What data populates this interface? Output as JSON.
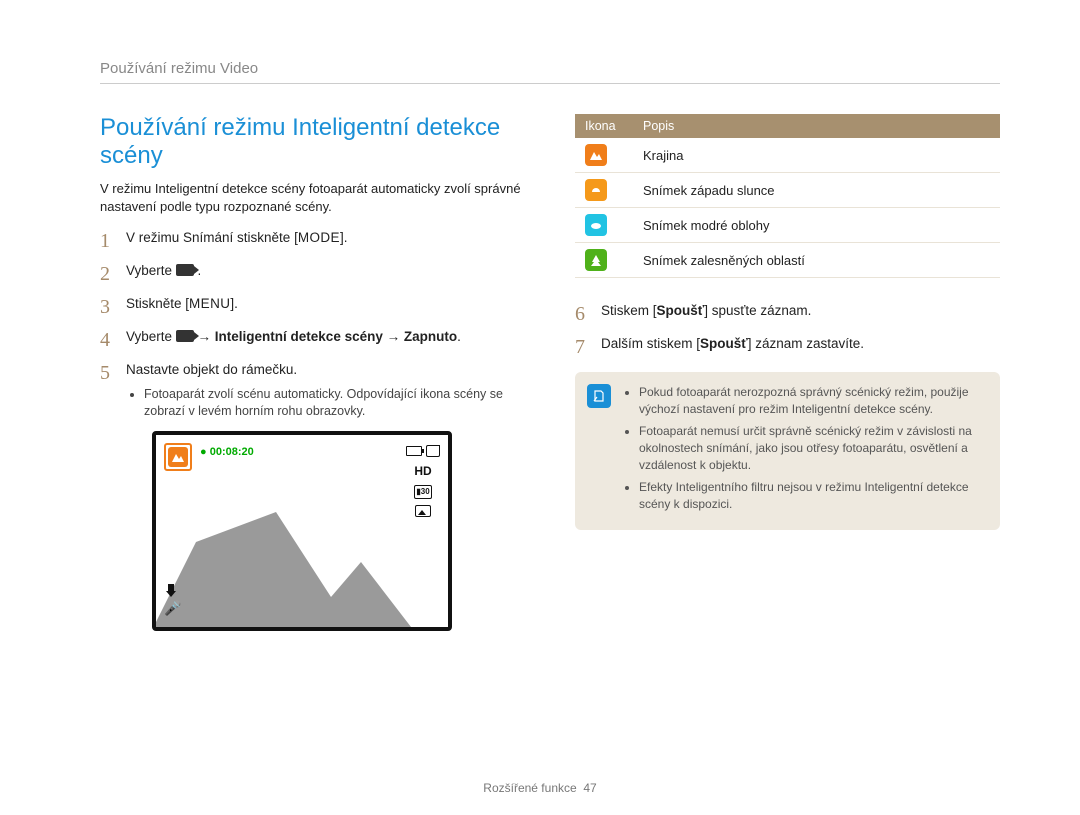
{
  "breadcrumb": "Používání režimu Video",
  "heading": "Používání režimu Inteligentní detekce scény",
  "intro": "V režimu Inteligentní detekce scény fotoaparát automaticky zvolí správné nastavení podle typu rozpoznané scény.",
  "steps": {
    "s1_a": "V režimu Snímání stiskněte [",
    "s1_btn": "MODE",
    "s1_b": "].",
    "s2_a": "Vyberte ",
    "s2_b": " .",
    "s3_a": "Stiskněte [",
    "s3_btn": "MENU",
    "s3_b": "].",
    "s4_a": "Vyberte ",
    "s4_b": " → ",
    "s4_bold": "Inteligentní detekce scény → Zapnuto",
    "s4_c": ".",
    "s5": "Nastavte objekt do rámečku.",
    "s5_sub": "Fotoaparát zvolí scénu automaticky. Odpovídající ikona scény se zobrazí v levém horním rohu obrazovky.",
    "s6_a": "Stiskem [",
    "s6_bold": "Spoušť",
    "s6_b": "] spusťte záznam.",
    "s7_a": "Dalším stiskem [",
    "s7_bold": "Spoušť",
    "s7_b": "] záznam zastavíte."
  },
  "preview": {
    "timer": "00:08:20",
    "hd": "HD"
  },
  "table": {
    "head_icon": "Ikona",
    "head_desc": "Popis",
    "rows": [
      {
        "desc": "Krajina"
      },
      {
        "desc": "Snímek západu slunce"
      },
      {
        "desc": "Snímek modré oblohy"
      },
      {
        "desc": "Snímek zalesněných oblastí"
      }
    ]
  },
  "notes": [
    "Pokud fotoaparát nerozpozná správný scénický režim, použije výchozí nastavení pro režim Inteligentní detekce scény.",
    "Fotoaparát nemusí určit správně scénický režim v závislosti na okolnostech snímání, jako jsou otřesy fotoaparátu, osvětlení a vzdálenost k objektu.",
    "Efekty Inteligentního filtru nejsou v režimu Inteligentní detekce scény k dispozici."
  ],
  "footer_label": "Rozšířené funkce",
  "footer_page": "47"
}
